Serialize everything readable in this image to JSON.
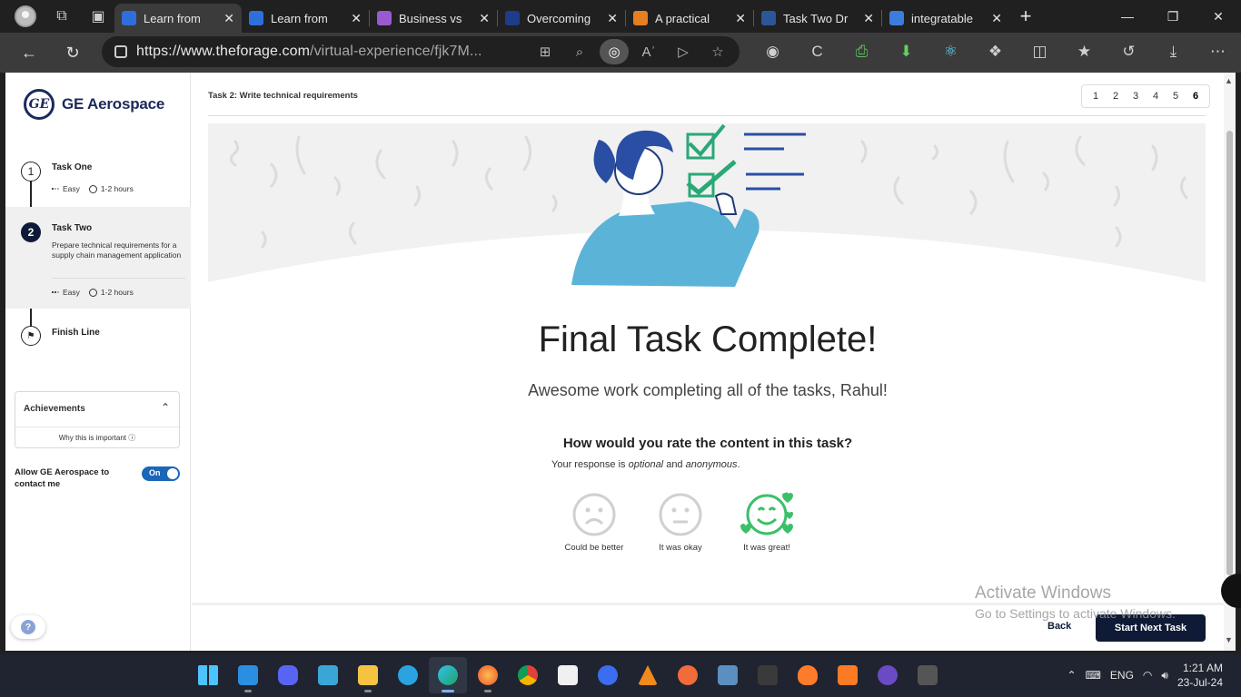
{
  "browser": {
    "tabs": [
      {
        "title": "Learn from",
        "color": "#2f6fdb",
        "active": true
      },
      {
        "title": "Learn from",
        "color": "#2f6fdb",
        "active": false
      },
      {
        "title": "Business vs",
        "color": "#9b59d0",
        "active": false
      },
      {
        "title": "Overcoming",
        "color": "#1e3c8c",
        "active": false
      },
      {
        "title": "A practical",
        "color": "#e67e22",
        "active": false
      },
      {
        "title": "Task Two Dr",
        "color": "#2b579a",
        "active": false
      },
      {
        "title": "integratable",
        "color": "#3b7ddd",
        "active": false
      }
    ],
    "url_host": "https://www.theforage.com",
    "url_path": "/virtual-experience/fjk7M..."
  },
  "sidebar": {
    "logo": "GE Aerospace",
    "logo_mark": "GE",
    "steps": [
      {
        "num": "1",
        "title": "Task One",
        "difficulty": "Easy",
        "duration": "1-2 hours"
      },
      {
        "num": "2",
        "title": "Task Two",
        "desc": "Prepare technical requirements for a supply chain management application",
        "difficulty": "Easy",
        "duration": "1-2 hours"
      },
      {
        "title": "Finish Line"
      }
    ],
    "achievements": {
      "title": "Achievements",
      "why": "Why this is important"
    },
    "contact_label": "Allow GE Aerospace to contact me",
    "toggle_label": "On",
    "help": "?"
  },
  "main": {
    "breadcrumb": "Task 2: Write technical requirements",
    "pages": [
      "1",
      "2",
      "3",
      "4",
      "5",
      "6"
    ],
    "current_page": "6",
    "title": "Final Task Complete!",
    "subtitle": "Awesome work completing all of the tasks, Rahul!",
    "rating_question": "How would you rate the content in this task?",
    "rating_note_pre": "Your response is ",
    "rating_note_optional": "optional",
    "rating_note_mid": " and ",
    "rating_note_anon": "anonymous",
    "rating_note_end": ".",
    "ratings": [
      {
        "label": "Could be better"
      },
      {
        "label": "It was okay"
      },
      {
        "label": "It was great!"
      }
    ],
    "back_label": "Back",
    "next_label": "Start Next Task"
  },
  "watermark": {
    "line1": "Activate Windows",
    "line2": "Go to Settings to activate Windows."
  },
  "taskbar": {
    "lang": "ENG",
    "time": "1:21 AM",
    "date": "23-Jul-24"
  }
}
